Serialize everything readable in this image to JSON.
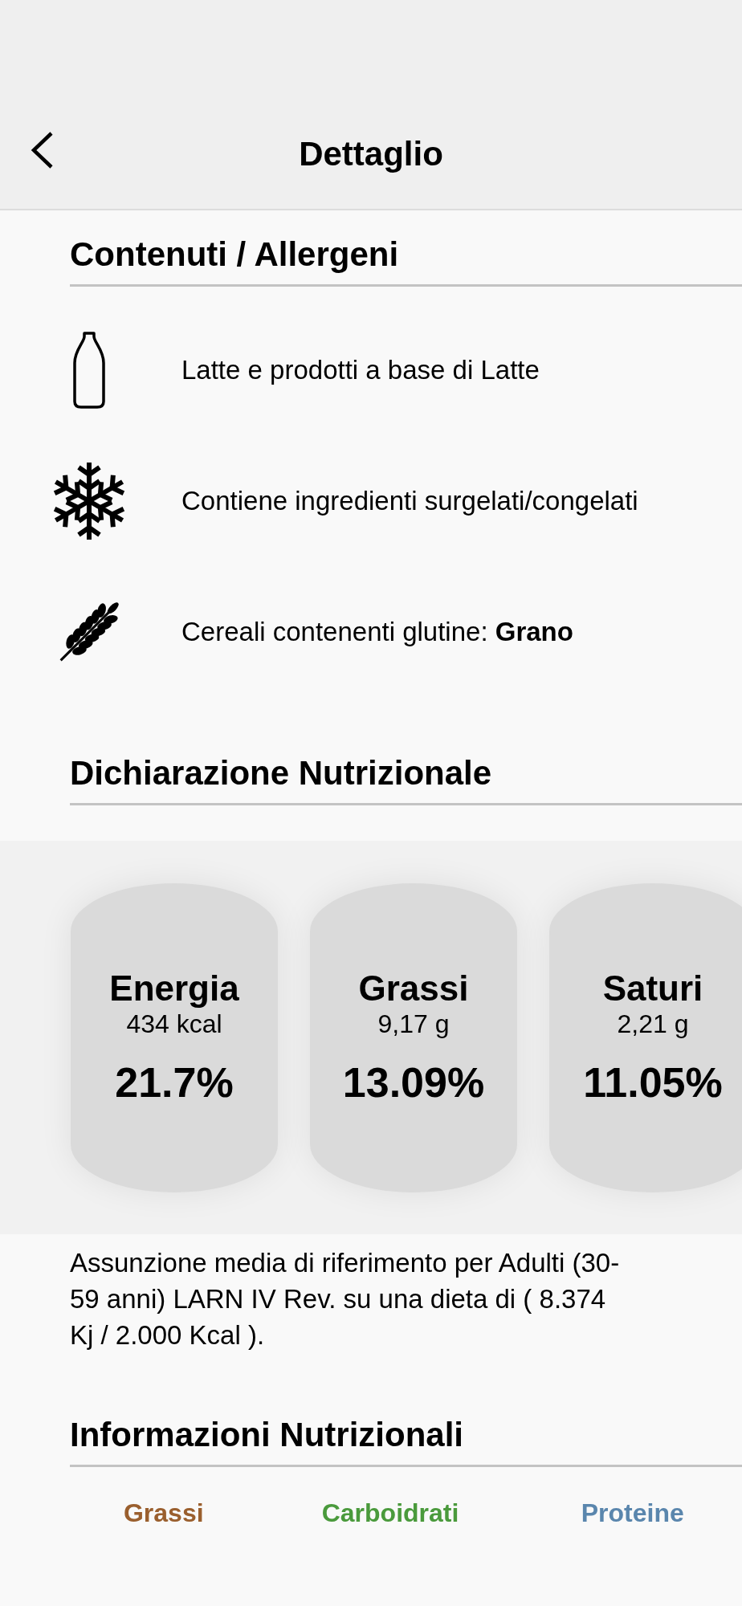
{
  "header": {
    "title": "Dettaglio"
  },
  "allergens": {
    "title": "Contenuti / Allergeni",
    "items": [
      {
        "kind": "milk",
        "text": "Latte e prodotti a base di Latte"
      },
      {
        "kind": "frozen",
        "text": "Contiene ingredienti surgelati/congelati"
      },
      {
        "kind": "gluten",
        "text": "Cereali contenenti glutine: **Grano**"
      }
    ]
  },
  "declaration": {
    "title": "Dichiarazione Nutrizionale",
    "cards": [
      {
        "name": "Energia",
        "amount": "434 kcal",
        "percent": "21.7%"
      },
      {
        "name": "Grassi",
        "amount": "9,17 g",
        "percent": "13.09%"
      },
      {
        "name": "Saturi",
        "amount": "2,21 g",
        "percent": "11.05%"
      }
    ],
    "note": "Assunzione media di riferimento per Adulti (30-59 anni) LARN IV Rev. su una dieta di ( 8.374 Kj / 2.000 Kcal )."
  },
  "information": {
    "title": "Informazioni Nutrizionali",
    "macros": [
      {
        "name": "Grassi",
        "color": "#9a5f2e"
      },
      {
        "name": "Carboidrati",
        "color": "#4a9a3c"
      },
      {
        "name": "Proteine",
        "color": "#5a86ad"
      }
    ]
  }
}
